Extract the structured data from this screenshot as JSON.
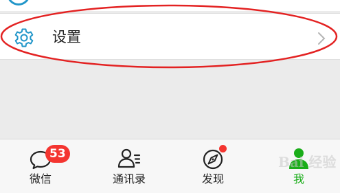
{
  "settings": {
    "label": "设置",
    "icon": "gear-icon",
    "chevron": "chevron-right-icon"
  },
  "tabbar": {
    "tabs": [
      {
        "label": "微信",
        "icon": "chat-bubble-icon",
        "badge": "53",
        "active": false
      },
      {
        "label": "通讯录",
        "icon": "contacts-icon",
        "active": false
      },
      {
        "label": "发现",
        "icon": "compass-icon",
        "dot": true,
        "active": false
      },
      {
        "label": "我",
        "icon": "person-icon",
        "active": true
      }
    ]
  },
  "watermark": {
    "text": "Bai 经验"
  },
  "colors": {
    "accent_green": "#1aad19",
    "badge_red": "#f43530",
    "icon_blue": "#2196c9",
    "annotation_red": "#e32222",
    "background": "#ebebeb"
  }
}
